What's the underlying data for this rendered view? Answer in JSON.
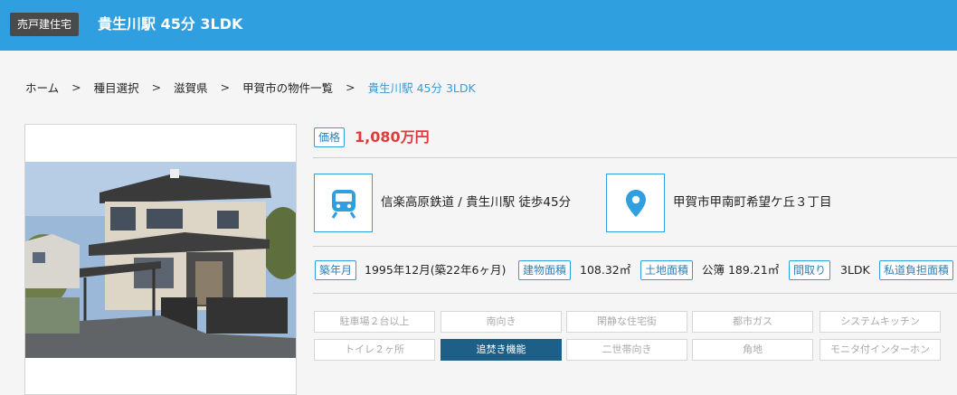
{
  "header": {
    "property_type": "売戸建住宅",
    "title": "貴生川駅 45分 3LDK"
  },
  "breadcrumb": {
    "items": [
      "ホーム",
      "種目選択",
      "滋賀県",
      "甲賀市の物件一覧"
    ],
    "current": "貴生川駅 45分 3LDK",
    "separator": ">"
  },
  "price": {
    "label": "価格",
    "value": "1,080万円"
  },
  "access": {
    "train_icon": "train-icon",
    "train_text": "信楽高原鉄道 / 貴生川駅 徒歩45分",
    "location_icon": "map-pin-icon",
    "address_text": "甲賀市甲南町希望ケ丘３丁目"
  },
  "specs": {
    "built_label": "築年月",
    "built_value": "1995年12月(築22年6ヶ月)",
    "building_area_label": "建物面積",
    "building_area_value": "108.32㎡",
    "land_area_label": "土地面積",
    "land_area_value": "公簿 189.21㎡",
    "layout_label": "間取り",
    "layout_value": "3LDK",
    "private_road_label": "私道負担面積"
  },
  "features": [
    {
      "label": "駐車場２台以上",
      "active": false
    },
    {
      "label": "南向き",
      "active": false
    },
    {
      "label": "閑静な住宅街",
      "active": false
    },
    {
      "label": "都市ガス",
      "active": false
    },
    {
      "label": "システムキッチン",
      "active": false
    },
    {
      "label": "トイレ２ヶ所",
      "active": false
    },
    {
      "label": "追焚き機能",
      "active": true
    },
    {
      "label": "二世帯向き",
      "active": false
    },
    {
      "label": "角地",
      "active": false
    },
    {
      "label": "モニタ付インターホン",
      "active": false
    }
  ],
  "colors": {
    "accent": "#2f9fe0",
    "price": "#e03a3a",
    "active_feature": "#1d5f86"
  }
}
